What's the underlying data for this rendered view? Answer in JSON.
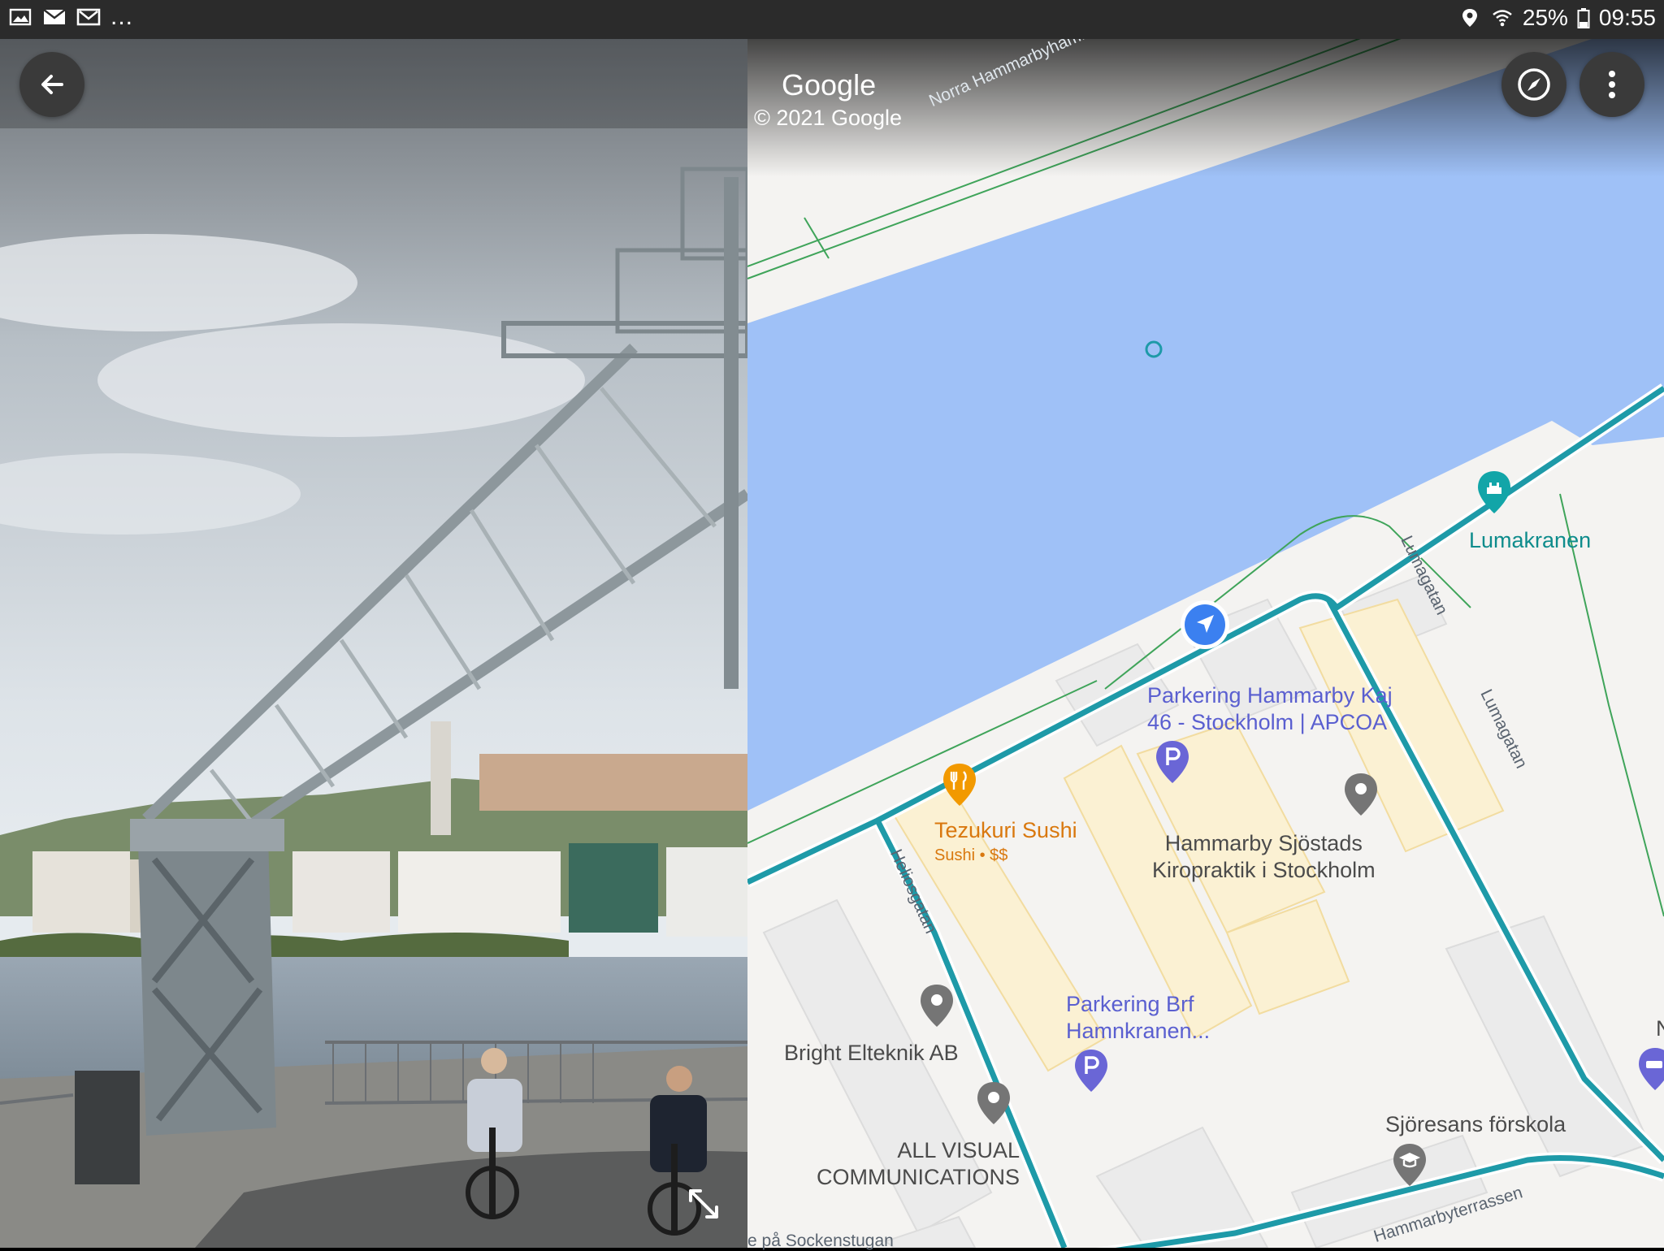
{
  "status_bar": {
    "time": "09:55",
    "battery": "25%",
    "more": "...",
    "icons": [
      "gallery-icon",
      "mail-icon",
      "gmail-icon",
      "location-icon",
      "wifi-icon",
      "battery-icon"
    ]
  },
  "street_view": {
    "back_icon": "arrow-left-icon",
    "expand_icon": "expand-diagonal-icon"
  },
  "map": {
    "brand": "Google",
    "copyright": "© 2021 Google",
    "compass_icon": "compass-icon",
    "menu_icon": "more-vert-icon",
    "streets": {
      "norra": "Norra Hammarbyhamnen",
      "lumagatan_top": "Lumagatan",
      "lumagatan_right": "Lumagatan",
      "heliosgatan": "Heliosgatan",
      "hammarbyterrassen": "Hammarbyterrassen",
      "bottom_partial": "e på Sockenstugan"
    },
    "pois": {
      "lumakranen": "Lumakranen",
      "parkering_kaj_line1": "Parkering Hammarby Kaj",
      "parkering_kaj_line2": "46 - Stockholm | APCOA",
      "tezukuri_name": "Tezukuri Sushi",
      "tezukuri_sub": "Sushi • $$",
      "kiropraktik_line1": "Hammarby Sjöstads",
      "kiropraktik_line2": "Kiropraktik i Stockholm",
      "parkering_brf_line1": "Parkering Brf",
      "parkering_brf_line2": "Hamnkranen...",
      "bright": "Bright Elteknik AB",
      "allvisual_line1": "ALL VISUAL",
      "allvisual_line2": "COMMUNICATIONS",
      "sjoresans": "Sjöresans förskola",
      "edge_partial": "N"
    },
    "colors": {
      "water": "#9fc1f7",
      "land": "#f4f3f1",
      "route": "#1e9aa8",
      "poi_blue": "#5a5fd0",
      "poi_grey": "#757575",
      "poi_teal": "#0e9aa0",
      "poi_orange": "#f29900",
      "location": "#3b80f0"
    }
  }
}
